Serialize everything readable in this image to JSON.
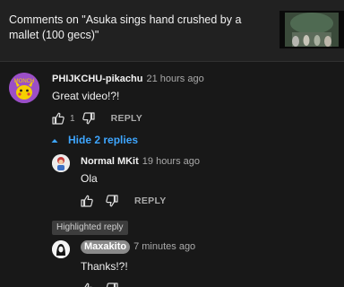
{
  "header": {
    "title": "Comments on \"Asuka sings hand crushed by a mallet (100 gecs)\""
  },
  "comments": [
    {
      "author": "PHIJKCHU-pikachu",
      "time": "21 hours ago",
      "text": "Great video!?!",
      "likes": "1",
      "reply_label": "REPLY",
      "avatar_icon": "pikachu-avatar"
    }
  ],
  "replies_toggle": {
    "label": "Hide 2 replies",
    "icon": "caret-up-icon"
  },
  "replies": [
    {
      "author": "Normal MKit",
      "time": "19 hours ago",
      "text": "Ola",
      "reply_label": "REPLY",
      "avatar_icon": "character-avatar"
    },
    {
      "badge": "Highlighted reply",
      "author": "Maxakito",
      "time": "7 minutes ago",
      "text": "Thanks!?!",
      "avatar_icon": "creator-avatar"
    }
  ],
  "colors": {
    "background": "#181818",
    "header_bg": "#212121",
    "link": "#3ea6ff",
    "muted": "#aaaaaa",
    "avatar_purple": "#9b4fc7"
  }
}
